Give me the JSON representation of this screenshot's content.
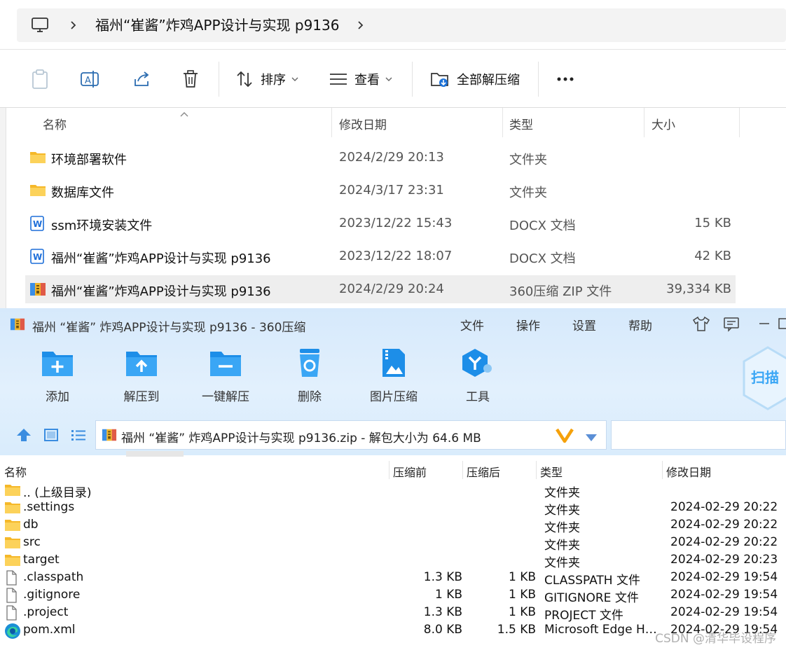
{
  "explorer": {
    "breadcrumb": "福州“崔酱”炸鸡APP设计与实现 p9136",
    "commands": {
      "sort": "排序",
      "view": "查看",
      "extract_all": "全部解压缩"
    },
    "columns": {
      "name": "名称",
      "date": "修改日期",
      "type": "类型",
      "size": "大小"
    },
    "rows": [
      {
        "name": "环境部署软件",
        "date": "2024/2/29 20:13",
        "type": "文件夹",
        "size": "",
        "icon": "folder-icon"
      },
      {
        "name": "数据库文件",
        "date": "2024/3/17 23:31",
        "type": "文件夹",
        "size": "",
        "icon": "folder-icon"
      },
      {
        "name": "ssm环境安装文件",
        "date": "2023/12/22 15:43",
        "type": "DOCX 文档",
        "size": "15 KB",
        "icon": "docx-icon"
      },
      {
        "name": "福州“崔酱”炸鸡APP设计与实现 p9136",
        "date": "2023/12/22 18:07",
        "type": "DOCX 文档",
        "size": "42 KB",
        "icon": "docx-icon"
      },
      {
        "name": "福州“崔酱”炸鸡APP设计与实现 p9136",
        "date": "2024/2/29 20:24",
        "type": "360压缩 ZIP 文件",
        "size": "39,334 KB",
        "icon": "zip-archive-icon"
      }
    ]
  },
  "zip": {
    "title": "福州 “崔酱” 炸鸡APP设计与实现 p9136 - 360压缩",
    "menu": [
      "文件",
      "操作",
      "设置",
      "帮助"
    ],
    "tools": [
      "添加",
      "解压到",
      "一键解压",
      "删除",
      "图片压缩",
      "工具"
    ],
    "scan_label": "扫描",
    "path": "福州 “崔酱” 炸鸡APP设计与实现 p9136.zip - 解包大小为 64.6 MB",
    "columns": {
      "name": "名称",
      "size": "压缩前",
      "packed": "压缩后",
      "type": "类型",
      "date": "修改日期"
    },
    "rows": [
      {
        "name": ".. (上级目录)",
        "size": "",
        "packed": "",
        "type": "文件夹",
        "date": "",
        "icon": "folder-icon"
      },
      {
        "name": ".settings",
        "size": "",
        "packed": "",
        "type": "文件夹",
        "date": "2024-02-29 20:22",
        "icon": "folder-icon"
      },
      {
        "name": "db",
        "size": "",
        "packed": "",
        "type": "文件夹",
        "date": "2024-02-29 20:22",
        "icon": "folder-icon"
      },
      {
        "name": "src",
        "size": "",
        "packed": "",
        "type": "文件夹",
        "date": "2024-02-29 20:22",
        "icon": "folder-icon"
      },
      {
        "name": "target",
        "size": "",
        "packed": "",
        "type": "文件夹",
        "date": "2024-02-29 20:23",
        "icon": "folder-icon"
      },
      {
        "name": ".classpath",
        "size": "1.3 KB",
        "packed": "1 KB",
        "type": "CLASSPATH 文件",
        "date": "2024-02-29 19:54",
        "icon": "file-icon"
      },
      {
        "name": ".gitignore",
        "size": "1 KB",
        "packed": "1 KB",
        "type": "GITIGNORE 文件",
        "date": "2024-02-29 19:54",
        "icon": "file-icon"
      },
      {
        "name": ".project",
        "size": "1.3 KB",
        "packed": "1 KB",
        "type": "PROJECT 文件",
        "date": "2024-02-29 19:54",
        "icon": "file-icon"
      },
      {
        "name": "pom.xml",
        "size": "8.0 KB",
        "packed": "1.5 KB",
        "type": "Microsoft Edge HT...",
        "date": "2024-02-29 19:54",
        "icon": "edge-icon"
      }
    ]
  },
  "watermark": "CSDN @清华毕设程序",
  "colors": {
    "folder": "#f7c244",
    "accent_blue": "#1e88e5",
    "zip_toolbar_bg": "#dcecfc",
    "selection": "#eeeeee"
  }
}
